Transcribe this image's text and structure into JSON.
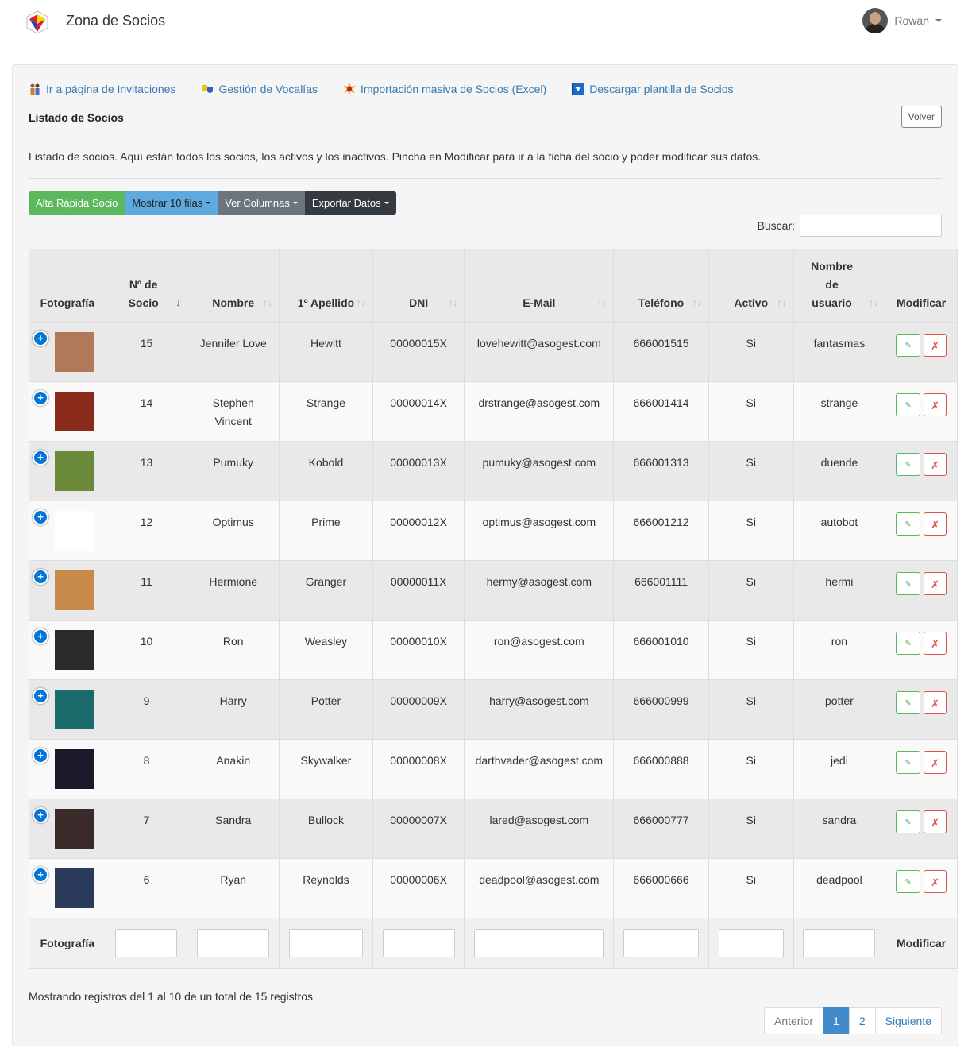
{
  "app": {
    "title": "Zona de Socios",
    "user_name": "Rowan"
  },
  "links": [
    {
      "label": "Ir a página de Invitaciones",
      "icon": "people-icon"
    },
    {
      "label": "Gestión de Vocalías",
      "icon": "masks-icon"
    },
    {
      "label": "Importación masiva de Socios (Excel)",
      "icon": "burst-icon"
    },
    {
      "label": "Descargar plantilla de Socios",
      "icon": "download-icon"
    }
  ],
  "page": {
    "title": "Listado de Socios",
    "back_label": "Volver",
    "description": "Listado de socios. Aquí están todos los socios, los activos y los inactivos. Pincha en Modificar para ir a la ficha del socio y poder modificar sus datos."
  },
  "toolbar": {
    "add": "Alta Rápida Socio",
    "show_rows": "Mostrar 10 filas",
    "columns": "Ver Columnas",
    "export": "Exportar Datos"
  },
  "search": {
    "label": "Buscar:"
  },
  "table": {
    "headers": {
      "photo": "Fotografía",
      "num": "Nº de Socio",
      "name": "Nombre",
      "surname": "1º Apellido",
      "dni": "DNI",
      "email": "E-Mail",
      "phone": "Teléfono",
      "active": "Activo",
      "username": "Nombre de usuario",
      "modify": "Modificar"
    },
    "rows": [
      {
        "num": "15",
        "name": "Jennifer Love",
        "surname": "Hewitt",
        "dni": "00000015X",
        "email": "lovehewitt@asogest.com",
        "phone": "666001515",
        "active": "Si",
        "username": "fantasmas",
        "photo_color": "#b07a5a"
      },
      {
        "num": "14",
        "name": "Stephen Vincent",
        "surname": "Strange",
        "dni": "00000014X",
        "email": "drstrange@asogest.com",
        "phone": "666001414",
        "active": "Si",
        "username": "strange",
        "photo_color": "#8a2a1a"
      },
      {
        "num": "13",
        "name": "Pumuky",
        "surname": "Kobold",
        "dni": "00000013X",
        "email": "pumuky@asogest.com",
        "phone": "666001313",
        "active": "Si",
        "username": "duende",
        "photo_color": "#6a8a3a"
      },
      {
        "num": "12",
        "name": "Optimus",
        "surname": "Prime",
        "dni": "00000012X",
        "email": "optimus@asogest.com",
        "phone": "666001212",
        "active": "Si",
        "username": "autobot",
        "photo_color": "#ffffff"
      },
      {
        "num": "11",
        "name": "Hermione",
        "surname": "Granger",
        "dni": "00000011X",
        "email": "hermy@asogest.com",
        "phone": "666001111",
        "active": "Si",
        "username": "hermi",
        "photo_color": "#c88a4a"
      },
      {
        "num": "10",
        "name": "Ron",
        "surname": "Weasley",
        "dni": "00000010X",
        "email": "ron@asogest.com",
        "phone": "666001010",
        "active": "Si",
        "username": "ron",
        "photo_color": "#2a2a2a"
      },
      {
        "num": "9",
        "name": "Harry",
        "surname": "Potter",
        "dni": "00000009X",
        "email": "harry@asogest.com",
        "phone": "666000999",
        "active": "Si",
        "username": "potter",
        "photo_color": "#1a6a6a"
      },
      {
        "num": "8",
        "name": "Anakin",
        "surname": "Skywalker",
        "dni": "00000008X",
        "email": "darthvader@asogest.com",
        "phone": "666000888",
        "active": "Si",
        "username": "jedi",
        "photo_color": "#1a1a2a"
      },
      {
        "num": "7",
        "name": "Sandra",
        "surname": "Bullock",
        "dni": "00000007X",
        "email": "lared@asogest.com",
        "phone": "666000777",
        "active": "Si",
        "username": "sandra",
        "photo_color": "#3a2a2a"
      },
      {
        "num": "6",
        "name": "Ryan",
        "surname": "Reynolds",
        "dni": "00000006X",
        "email": "deadpool@asogest.com",
        "phone": "666000666",
        "active": "Si",
        "username": "deadpool",
        "photo_color": "#2a3a5a"
      }
    ],
    "footer": {
      "photo": "Fotografía",
      "modify": "Modificar"
    }
  },
  "info": "Mostrando registros del 1 al 10 de un total de 15 registros",
  "pagination": {
    "prev": "Anterior",
    "pages": [
      "1",
      "2"
    ],
    "next": "Siguiente",
    "current": "1"
  }
}
